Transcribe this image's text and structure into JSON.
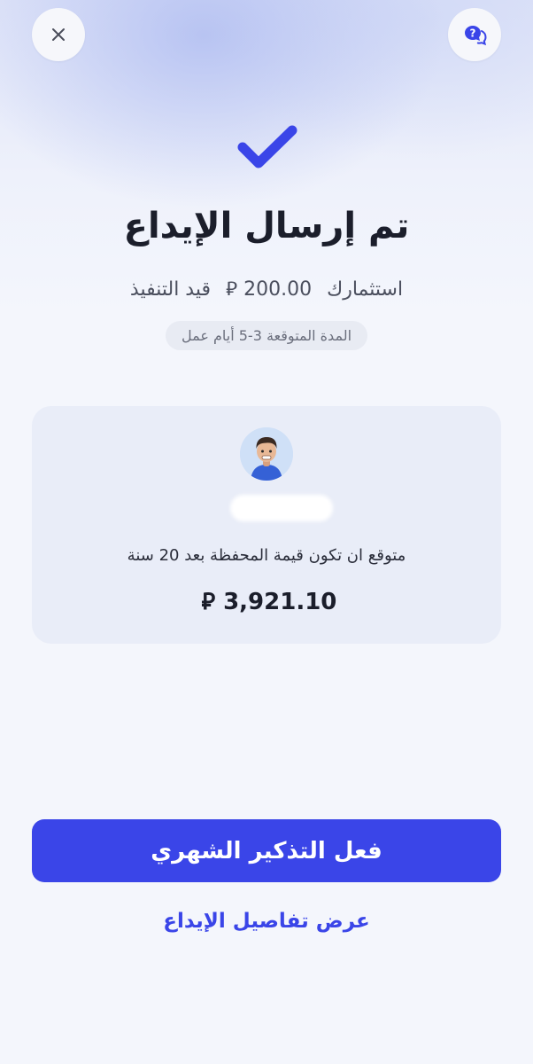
{
  "header": {
    "close_icon": "close-icon",
    "help_icon": "help-chat-icon"
  },
  "status": {
    "icon": "checkmark-icon",
    "title": "تم إرسال الإيداع",
    "investment_label": "استثمارك",
    "amount": "200.00",
    "currency_symbol": "⃁",
    "state": "قيد التنفيذ",
    "duration": "المدة المتوقعة 3-5 أيام عمل"
  },
  "projection": {
    "description": "متوقع ان تكون قيمة المحفظة بعد 20 سنة",
    "value": "3,921.10",
    "currency_symbol": "⃁"
  },
  "actions": {
    "primary_label": "فعل التذكير الشهري",
    "secondary_label": "عرض تفاصيل الإيداع"
  },
  "colors": {
    "accent": "#3a45e8",
    "card_bg": "#e9edf8",
    "page_bg": "#f4f6fc"
  }
}
